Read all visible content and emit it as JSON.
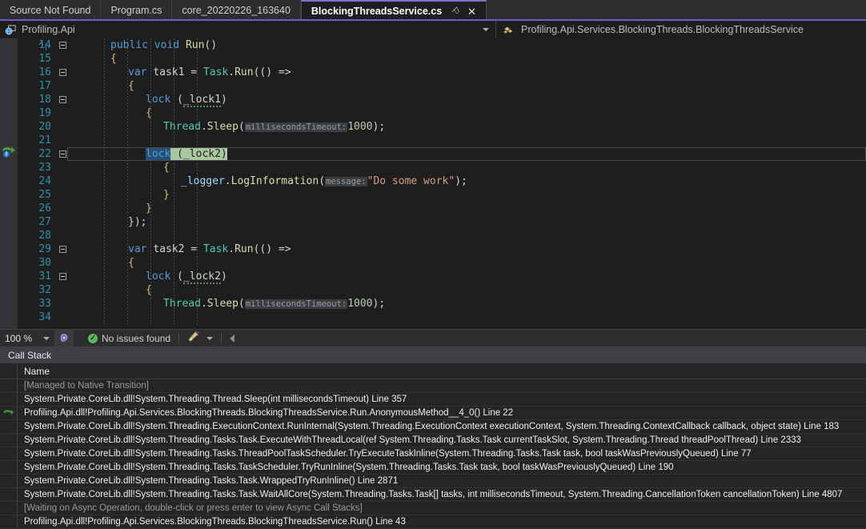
{
  "window": {
    "accent_color": "#6b5fc0",
    "background": "#1e1e1e"
  },
  "tabs": [
    {
      "label": "Source Not Found",
      "active": false
    },
    {
      "label": "Program.cs",
      "active": false
    },
    {
      "label": "core_20220226_163640",
      "active": false
    },
    {
      "label": "BlockingThreadsService.cs",
      "active": true,
      "pin_glyph": "⚐",
      "close_glyph": "✕"
    }
  ],
  "navbar": {
    "project": "Profiling.Api",
    "member": "Profiling.Api.Services.BlockingThreads.BlockingThreadsService",
    "dropdown_caret": "▼"
  },
  "editor": {
    "first_line": 14,
    "current_line": 22,
    "lines": [
      {
        "n": 14,
        "collapse": true,
        "indent": 2,
        "tokens": [
          {
            "t": "public",
            "c": "kw"
          },
          {
            "t": " ",
            "c": "punc"
          },
          {
            "t": "void",
            "c": "kw"
          },
          {
            "t": " ",
            "c": "punc"
          },
          {
            "t": "Run",
            "c": "meth"
          },
          {
            "t": "()",
            "c": "punc"
          }
        ]
      },
      {
        "n": 15,
        "collapse": false,
        "indent": 2,
        "tokens": [
          {
            "t": "{",
            "c": "brace"
          }
        ]
      },
      {
        "n": 16,
        "collapse": true,
        "indent": 3,
        "tokens": [
          {
            "t": "var",
            "c": "kw"
          },
          {
            "t": " ",
            "c": "punc"
          },
          {
            "t": "task1",
            "c": "id"
          },
          {
            "t": " = ",
            "c": "punc"
          },
          {
            "t": "Task",
            "c": "type"
          },
          {
            "t": ".",
            "c": "punc"
          },
          {
            "t": "Run",
            "c": "meth"
          },
          {
            "t": "(() =>",
            "c": "punc"
          }
        ]
      },
      {
        "n": 17,
        "collapse": false,
        "indent": 3,
        "tokens": [
          {
            "t": "{",
            "c": "brace"
          }
        ]
      },
      {
        "n": 18,
        "collapse": true,
        "indent": 4,
        "tokens": [
          {
            "t": "lock",
            "c": "kw"
          },
          {
            "t": " (",
            "c": "punc"
          },
          {
            "t": "_lock1",
            "c": "id squiggle"
          },
          {
            "t": ")",
            "c": "punc"
          }
        ]
      },
      {
        "n": 19,
        "collapse": false,
        "indent": 4,
        "tokens": [
          {
            "t": "{",
            "c": "brace"
          }
        ]
      },
      {
        "n": 20,
        "collapse": false,
        "indent": 5,
        "tokens": [
          {
            "t": "Thread",
            "c": "type"
          },
          {
            "t": ".",
            "c": "punc"
          },
          {
            "t": "Sleep",
            "c": "meth"
          },
          {
            "t": "(",
            "c": "punc"
          },
          {
            "t": "millisecondsTimeout:",
            "c": "param-hint"
          },
          {
            "t": "1000",
            "c": "num"
          },
          {
            "t": ");",
            "c": "punc"
          }
        ]
      },
      {
        "n": 21,
        "collapse": false,
        "indent": 5,
        "tokens": []
      },
      {
        "n": 22,
        "collapse": true,
        "indent": 4,
        "current": true,
        "tokens": [
          {
            "t": "lock",
            "c": "sel-blue"
          },
          {
            "t": " (_lock2)",
            "c": "stmt-green"
          }
        ]
      },
      {
        "n": 23,
        "collapse": false,
        "indent": 5,
        "tokens": [
          {
            "t": "{",
            "c": "brace"
          }
        ]
      },
      {
        "n": 24,
        "collapse": false,
        "indent": 6,
        "tokens": [
          {
            "t": "_logger",
            "c": "var"
          },
          {
            "t": ".",
            "c": "punc"
          },
          {
            "t": "LogInformation",
            "c": "meth"
          },
          {
            "t": "(",
            "c": "punc"
          },
          {
            "t": "message:",
            "c": "param-hint"
          },
          {
            "t": "\"Do some work\"",
            "c": "str"
          },
          {
            "t": ");",
            "c": "punc"
          }
        ]
      },
      {
        "n": 25,
        "collapse": false,
        "indent": 5,
        "tokens": [
          {
            "t": "}",
            "c": "brace"
          }
        ]
      },
      {
        "n": 26,
        "collapse": false,
        "indent": 4,
        "tokens": [
          {
            "t": "}",
            "c": "brace"
          }
        ]
      },
      {
        "n": 27,
        "collapse": false,
        "indent": 3,
        "tokens": [
          {
            "t": "});",
            "c": "punc"
          }
        ]
      },
      {
        "n": 28,
        "collapse": false,
        "indent": 3,
        "tokens": []
      },
      {
        "n": 29,
        "collapse": true,
        "indent": 3,
        "tokens": [
          {
            "t": "var",
            "c": "kw"
          },
          {
            "t": " ",
            "c": "punc"
          },
          {
            "t": "task2",
            "c": "id"
          },
          {
            "t": " = ",
            "c": "punc"
          },
          {
            "t": "Task",
            "c": "type"
          },
          {
            "t": ".",
            "c": "punc"
          },
          {
            "t": "Run",
            "c": "meth"
          },
          {
            "t": "(() =>",
            "c": "punc"
          }
        ]
      },
      {
        "n": 30,
        "collapse": false,
        "indent": 3,
        "tokens": [
          {
            "t": "{",
            "c": "brace"
          }
        ]
      },
      {
        "n": 31,
        "collapse": true,
        "indent": 4,
        "tokens": [
          {
            "t": "lock",
            "c": "kw"
          },
          {
            "t": " (",
            "c": "punc"
          },
          {
            "t": "_lock2",
            "c": "id squiggle"
          },
          {
            "t": ")",
            "c": "punc"
          }
        ]
      },
      {
        "n": 32,
        "collapse": false,
        "indent": 4,
        "tokens": [
          {
            "t": "{",
            "c": "brace"
          }
        ]
      },
      {
        "n": 33,
        "collapse": false,
        "indent": 5,
        "tokens": [
          {
            "t": "Thread",
            "c": "type"
          },
          {
            "t": ".",
            "c": "punc"
          },
          {
            "t": "Sleep",
            "c": "meth"
          },
          {
            "t": "(",
            "c": "punc"
          },
          {
            "t": "millisecondsTimeout:",
            "c": "param-hint"
          },
          {
            "t": "1000",
            "c": "num"
          },
          {
            "t": ");",
            "c": "punc"
          }
        ]
      },
      {
        "n": 34,
        "collapse": false,
        "indent": 5,
        "tokens": []
      }
    ]
  },
  "editor_status": {
    "zoom": "100 %",
    "issues_text": "No issues found",
    "issues_icon": "check-circle-ok",
    "speaker_icon": "intellicode-icon",
    "broom_icon": "code-cleanup-icon",
    "dropdown_caret": "▼",
    "scroll_left_icon": "◀"
  },
  "callstack": {
    "title": "Call Stack",
    "columns": [
      "Name"
    ],
    "rows": [
      {
        "marker": "",
        "name": "[Managed to Native Transition]",
        "dim": true
      },
      {
        "marker": "",
        "name": "System.Private.CoreLib.dll!System.Threading.Thread.Sleep(int millisecondsTimeout) Line 357",
        "dim": false
      },
      {
        "marker": "arrow",
        "name": "Profiling.Api.dll!Profiling.Api.Services.BlockingThreads.BlockingThreadsService.Run.AnonymousMethod__4_0() Line 22",
        "dim": false
      },
      {
        "marker": "",
        "name": "System.Private.CoreLib.dll!System.Threading.ExecutionContext.RunInternal(System.Threading.ExecutionContext executionContext, System.Threading.ContextCallback callback, object state) Line 183",
        "dim": false
      },
      {
        "marker": "",
        "name": "System.Private.CoreLib.dll!System.Threading.Tasks.Task.ExecuteWithThreadLocal(ref System.Threading.Tasks.Task currentTaskSlot, System.Threading.Thread threadPoolThread) Line 2333",
        "dim": false
      },
      {
        "marker": "",
        "name": "System.Private.CoreLib.dll!System.Threading.Tasks.ThreadPoolTaskScheduler.TryExecuteTaskInline(System.Threading.Tasks.Task task, bool taskWasPreviouslyQueued) Line 77",
        "dim": false
      },
      {
        "marker": "",
        "name": "System.Private.CoreLib.dll!System.Threading.Tasks.TaskScheduler.TryRunInline(System.Threading.Tasks.Task task, bool taskWasPreviouslyQueued) Line 190",
        "dim": false
      },
      {
        "marker": "",
        "name": "System.Private.CoreLib.dll!System.Threading.Tasks.Task.WrappedTryRunInline() Line 2871",
        "dim": false
      },
      {
        "marker": "",
        "name": "System.Private.CoreLib.dll!System.Threading.Tasks.Task.WaitAllCore(System.Threading.Tasks.Task[] tasks, int millisecondsTimeout, System.Threading.CancellationToken cancellationToken) Line 4807",
        "dim": false
      },
      {
        "marker": "",
        "name": "[Waiting on Async Operation, double-click or press enter to view Async Call Stacks]",
        "dim": true
      },
      {
        "marker": "",
        "name": "Profiling.Api.dll!Profiling.Api.Services.BlockingThreads.BlockingThreadsService.Run() Line 43",
        "dim": false
      }
    ]
  }
}
